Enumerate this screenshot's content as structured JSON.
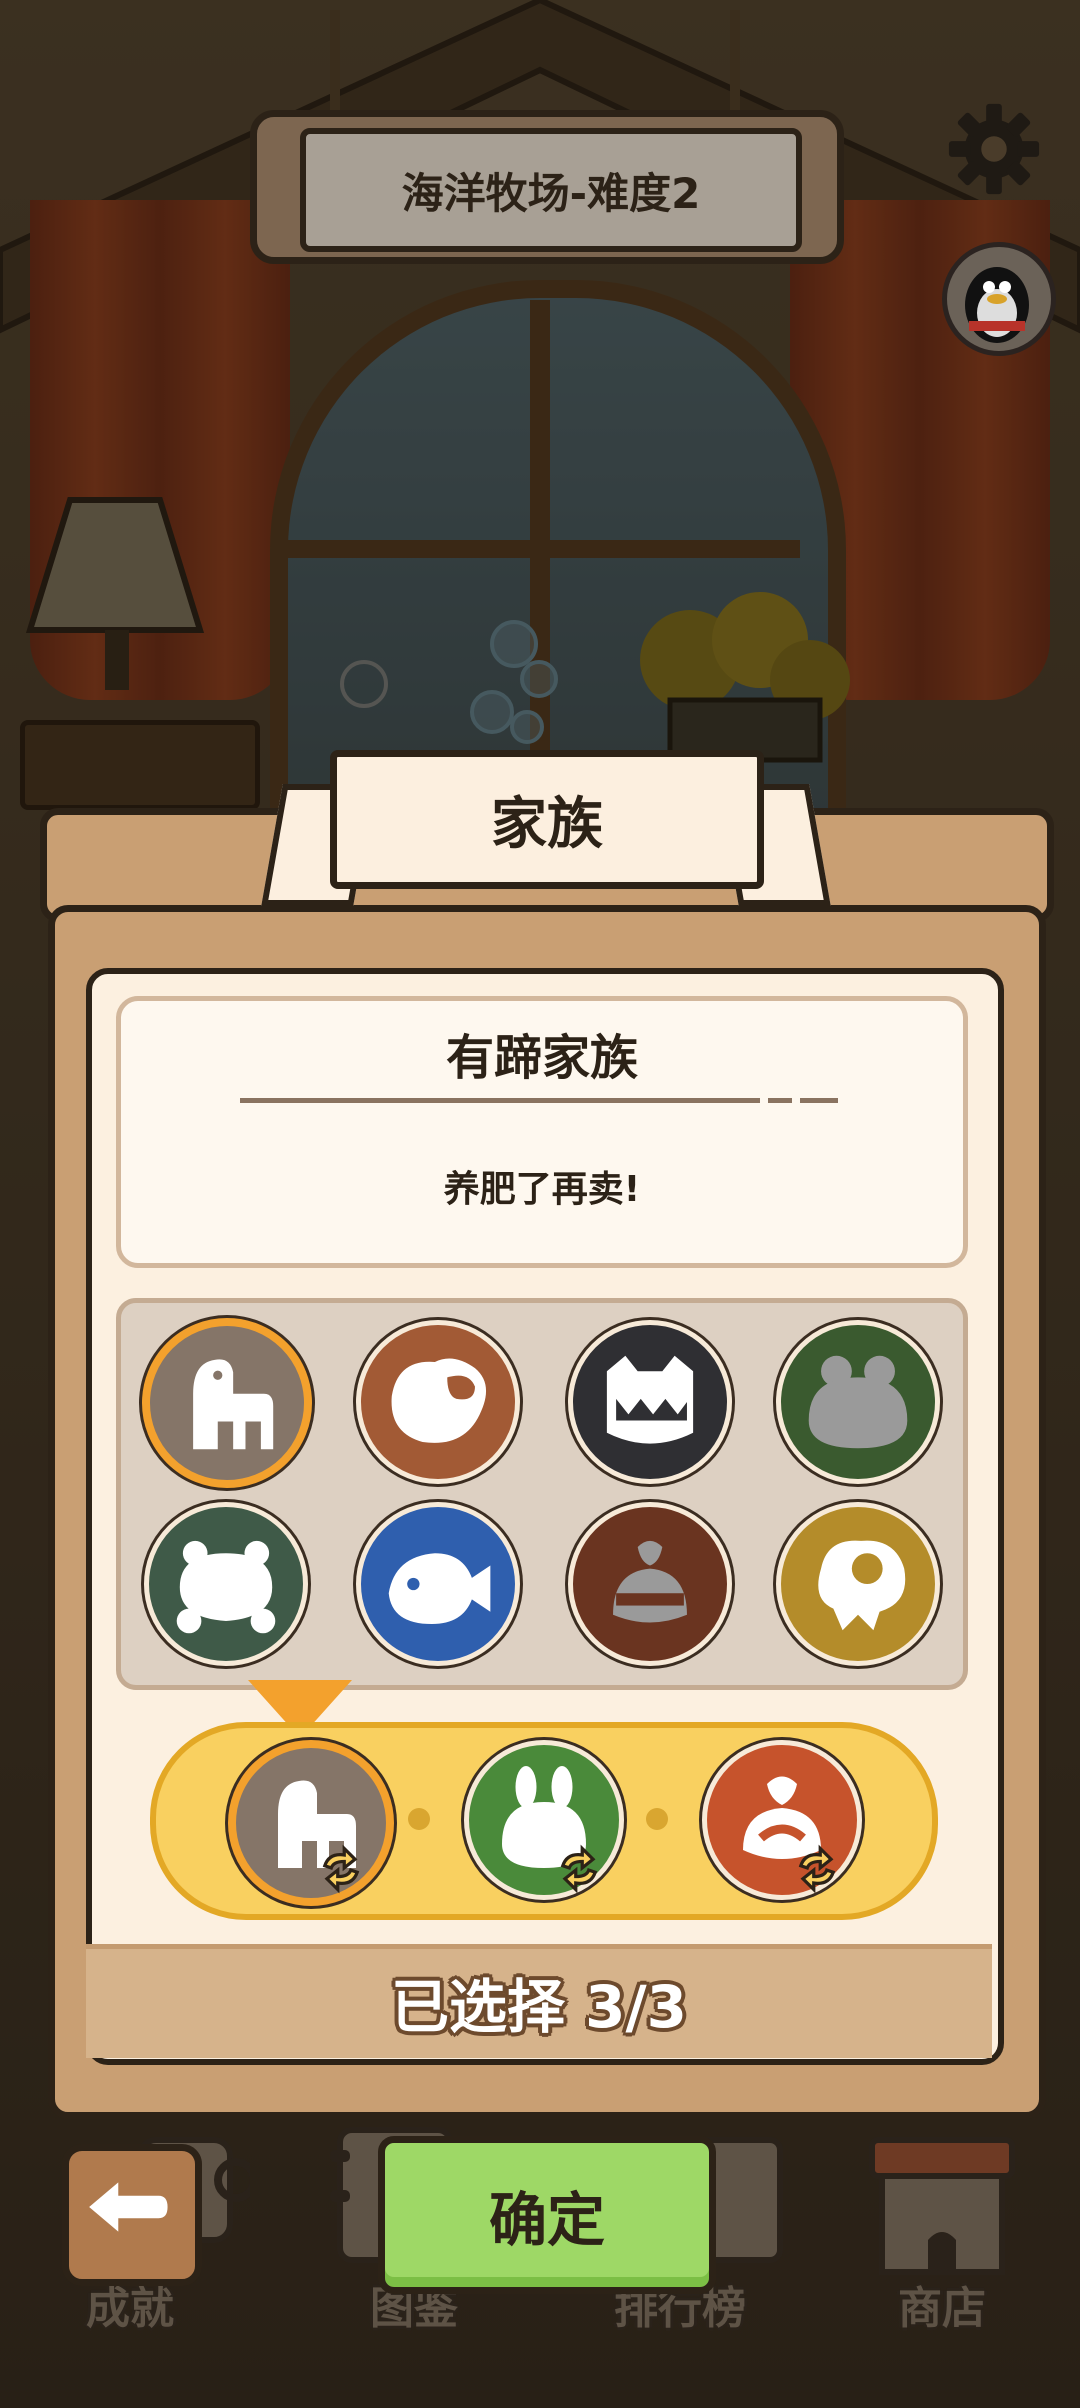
{
  "header": {
    "level_title": "海洋牧场-难度2"
  },
  "dialog": {
    "title": "家族",
    "family_name": "有蹄家族",
    "family_description": "养肥了再卖!",
    "selected_count": "已选择 3/3"
  },
  "families": [
    {
      "name": "hoofed-family",
      "color": "#857568",
      "selected": true
    },
    {
      "name": "bird-family",
      "color": "#a25a35",
      "selected": false
    },
    {
      "name": "shark-family",
      "color": "#2f2f33",
      "selected": false
    },
    {
      "name": "frog-family",
      "color": "#3a5a2f",
      "selected": false
    },
    {
      "name": "turtle-family",
      "color": "#3f5a48",
      "selected": false
    },
    {
      "name": "fish-family",
      "color": "#2f5fae",
      "selected": false
    },
    {
      "name": "sausage-family",
      "color": "#6a3420",
      "selected": false
    },
    {
      "name": "egg-family",
      "color": "#b48c2a",
      "selected": false
    }
  ],
  "slots": [
    {
      "name": "hoofed-family",
      "color": "#857568"
    },
    {
      "name": "rabbit-family",
      "color": "#4a8a3a"
    },
    {
      "name": "bag-family",
      "color": "#c6532c"
    }
  ],
  "buttons": {
    "confirm": "确定"
  },
  "nav": {
    "achievements": "成就",
    "collection": "图鉴",
    "leaderboard": "排行榜",
    "shop": "商店"
  }
}
